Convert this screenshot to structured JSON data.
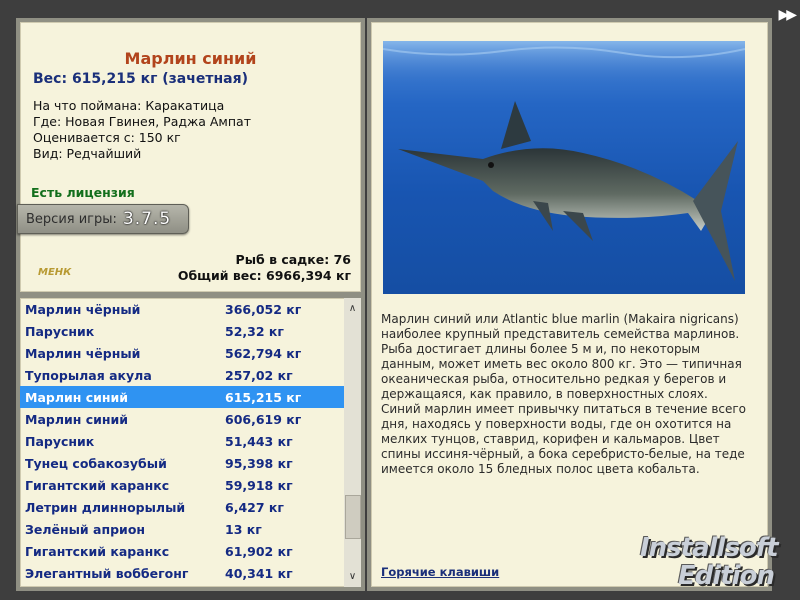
{
  "nav": {
    "next_icon": "fast-forward-icon"
  },
  "fish": {
    "title": "Марлин синий",
    "weight": "Вес: 615,215 кг (зачетная)",
    "caught_on": "На что поймана: Каракатица",
    "location": "Где: Новая Гвинея, Раджа Ампат",
    "valued_from": "Оценивается с: 150 кг",
    "rarity": "Вид: Редчайший",
    "license": "Есть лицензия"
  },
  "version": {
    "label": "Версия игры:",
    "value": "3.7.5"
  },
  "stats": {
    "fish_in_net": "Рыб в садке: 76",
    "total_weight": "Общий вес: 6966,394 кг"
  },
  "logo_small": "МЕНК",
  "catch_list": [
    {
      "name": "Марлин чёрный",
      "weight": "366,052 кг"
    },
    {
      "name": "Парусник",
      "weight": "52,32 кг"
    },
    {
      "name": "Марлин чёрный",
      "weight": "562,794 кг"
    },
    {
      "name": "Тупорылая акула",
      "weight": "257,02 кг"
    },
    {
      "name": "Марлин синий",
      "weight": "615,215 кг",
      "selected": true
    },
    {
      "name": "Марлин синий",
      "weight": "606,619 кг"
    },
    {
      "name": "Парусник",
      "weight": "51,443 кг"
    },
    {
      "name": "Тунец собакозубый",
      "weight": "95,398 кг"
    },
    {
      "name": "Гигантский каранкс",
      "weight": "59,918 кг"
    },
    {
      "name": "Летрин длиннорылый",
      "weight": "6,427 кг"
    },
    {
      "name": "Зелёный априон",
      "weight": "13 кг"
    },
    {
      "name": "Гигантский каранкс",
      "weight": "61,902 кг"
    },
    {
      "name": "Элегантный воббегонг",
      "weight": "40,341 кг"
    }
  ],
  "selected_color": "#2f93f2",
  "description": "Марлин синий или Atlantic blue marlin (Makaira nigricans) наиболее крупный представитель семейства марлинов. Рыба достигает длины более 5 м и, по некоторым данным, может иметь вес около 800 кг. Это — типичная океаническая рыба, относительно редкая у берегов и держащаяся, как правило, в поверхностных слоях. Синий марлин имеет привычку питаться в течение всего дня, находясь у поверхности воды, где он охотится на мелких тунцов, ставрид, корифен и кальмаров. Цвет спины иссиня-чёрный, а бока серебристо-белые, на теде имеется около 15 бледных полос цвета кобальта.",
  "hotkeys_link": "Горячие клавиши",
  "watermark": {
    "line1": "Installsoft",
    "line2": "Edition"
  }
}
